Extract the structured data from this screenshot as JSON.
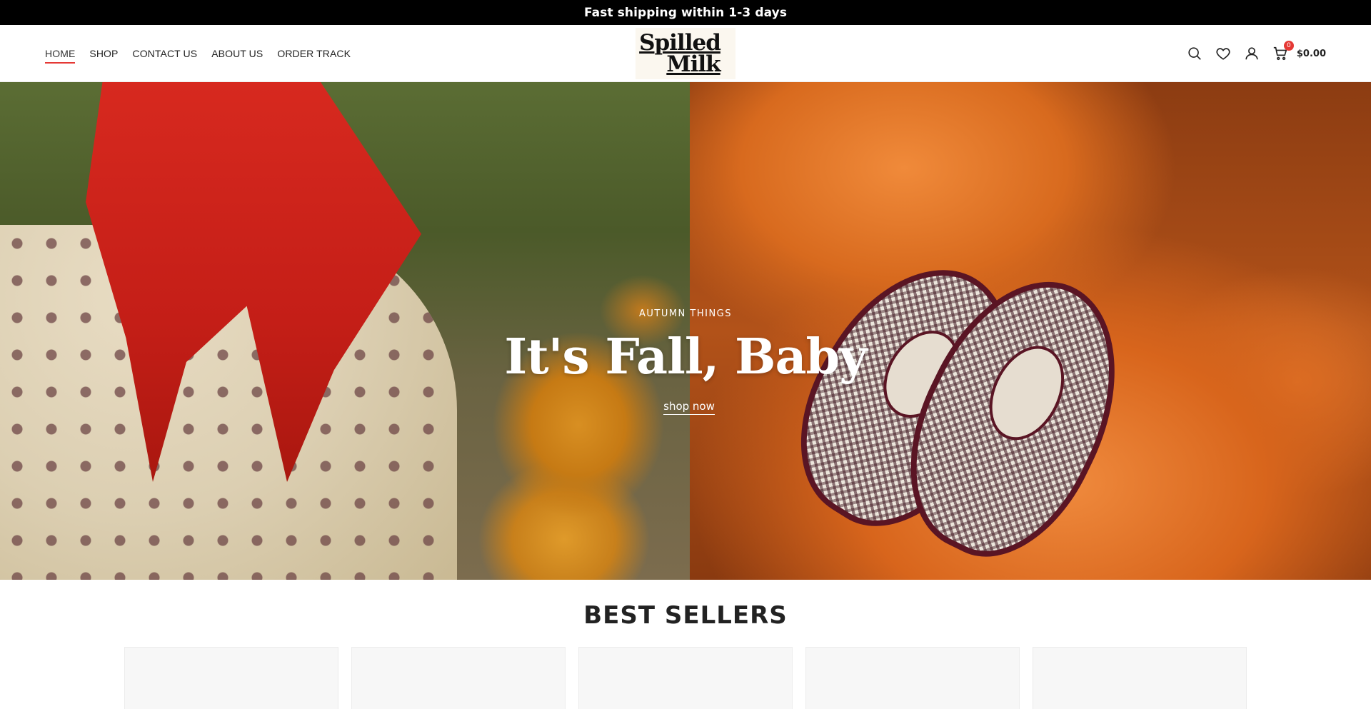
{
  "announcement": {
    "text": "Fast shipping within 1-3 days"
  },
  "nav": {
    "items": [
      {
        "label": "HOME",
        "active": true
      },
      {
        "label": "SHOP",
        "active": false
      },
      {
        "label": "CONTACT US",
        "active": false
      },
      {
        "label": "ABOUT US",
        "active": false
      },
      {
        "label": "ORDER TRACK",
        "active": false
      }
    ]
  },
  "logo": {
    "line1": "Spilled",
    "line2": "Milk"
  },
  "header_icons": {
    "search": "search-icon",
    "wishlist": "heart-icon",
    "account": "user-icon",
    "cart": "cart-icon",
    "cart_count": "0",
    "cart_total": "$0.00"
  },
  "hero": {
    "subtitle": "AUTUMN THINGS",
    "title": "It's Fall, Baby",
    "cta": "shop now"
  },
  "best_sellers": {
    "title": "BEST SELLERS",
    "product_thumb_colors": [
      "#f3c9c0",
      "#f7f7f7",
      "#c9a78d",
      "#d9b7b0",
      "#8fa6c8"
    ]
  },
  "colors": {
    "accent": "#e53935",
    "topbar": "#000000"
  }
}
